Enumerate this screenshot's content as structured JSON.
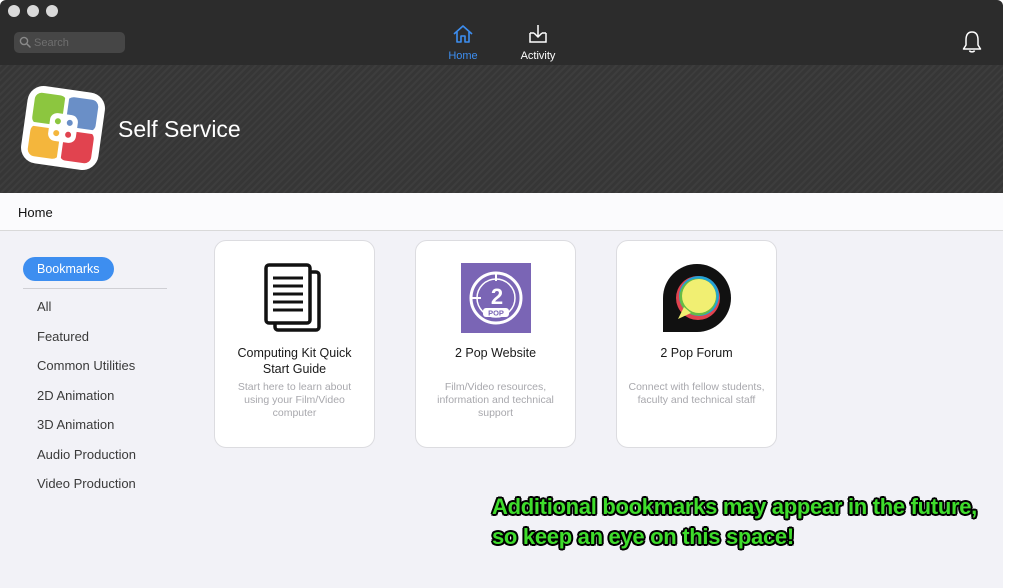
{
  "toolbar": {
    "search_placeholder": "Search",
    "tabs": [
      {
        "label": "Home",
        "icon": "home-icon",
        "active": true
      },
      {
        "label": "Activity",
        "icon": "download-tray-icon",
        "active": false
      }
    ],
    "notifications_icon": "bell-icon"
  },
  "banner": {
    "title": "Self Service",
    "logo_icon": "self-service-logo",
    "logo_colors": [
      "#8cc63f",
      "#6a8fc7",
      "#f4b63c",
      "#e1434f"
    ]
  },
  "breadcrumb": "Home",
  "sidebar": {
    "selected": "Bookmarks",
    "categories": [
      "All",
      "Featured",
      "Common Utilities",
      "2D Animation",
      "3D Animation",
      "Audio Production",
      "Video Production"
    ]
  },
  "cards": [
    {
      "title": "Computing Kit Quick Start Guide",
      "description": "Start here to learn about using your Film/Video computer",
      "icon": "document-stack-icon"
    },
    {
      "title": "2 Pop Website",
      "description": "Film/Video resources, information and technical support",
      "icon": "2pop-logo-icon",
      "icon_color": "#7a65b5",
      "icon_text": "2",
      "icon_subtext": "POP"
    },
    {
      "title": "2 Pop Forum",
      "description": "Connect with fellow students, faculty and technical staff",
      "icon": "discourse-chat-bubble-icon"
    }
  ],
  "annotation": {
    "line1": "Additional bookmarks may appear in the future,",
    "line2": "so keep an eye on this space!",
    "color": "#3fdc2c"
  },
  "colors": {
    "accent": "#3d8ef0",
    "toolbar_bg": "#2c2c2c",
    "banner_bg": "#363636"
  }
}
